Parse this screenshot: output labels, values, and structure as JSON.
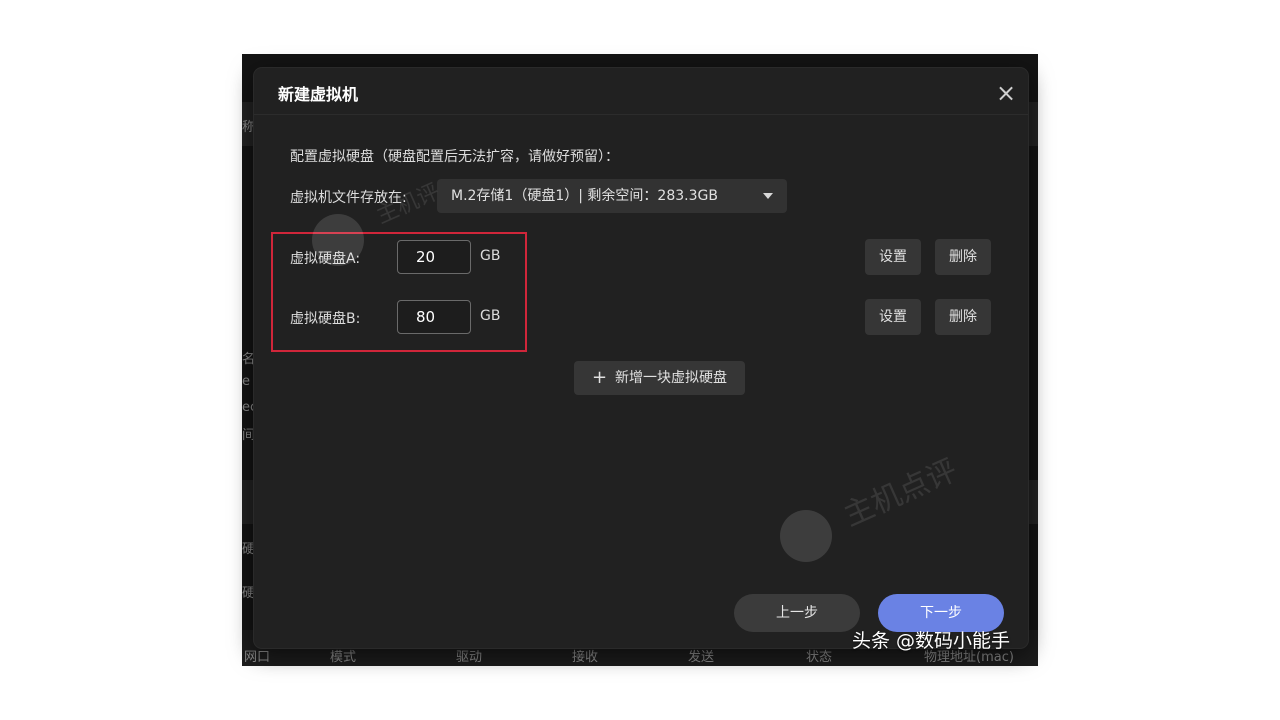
{
  "background": {
    "columns": [
      "网口",
      "模式",
      "驱动",
      "接收",
      "发送",
      "状态",
      "物理地址(mac)"
    ],
    "left_fragments": [
      "称",
      "名",
      "e",
      "ec",
      "间",
      "硬",
      "硬"
    ]
  },
  "dialog": {
    "title": "新建虚拟机",
    "close_icon": "close-icon",
    "section_label": "配置虚拟硬盘（硬盘配置后无法扩容，请做好预留）：",
    "storage_label": "虚拟机文件存放在:",
    "storage_select": "M.2存储1（硬盘1）| 剩余空间：283.3GB",
    "disks": [
      {
        "label": "虚拟硬盘A:",
        "size": "20",
        "unit": "GB",
        "settings": "设置",
        "delete": "删除"
      },
      {
        "label": "虚拟硬盘B:",
        "size": "80",
        "unit": "GB",
        "settings": "设置",
        "delete": "删除"
      }
    ],
    "add_disk": "新增一块虚拟硬盘",
    "prev": "上一步",
    "next": "下一步"
  },
  "watermark": "主机点评",
  "watermark2": "主机评",
  "credit": "头条 @数码小能手",
  "colors": {
    "dialog_bg": "#212121",
    "primary": "#6a82e4",
    "highlight_box": "#d0263a"
  }
}
